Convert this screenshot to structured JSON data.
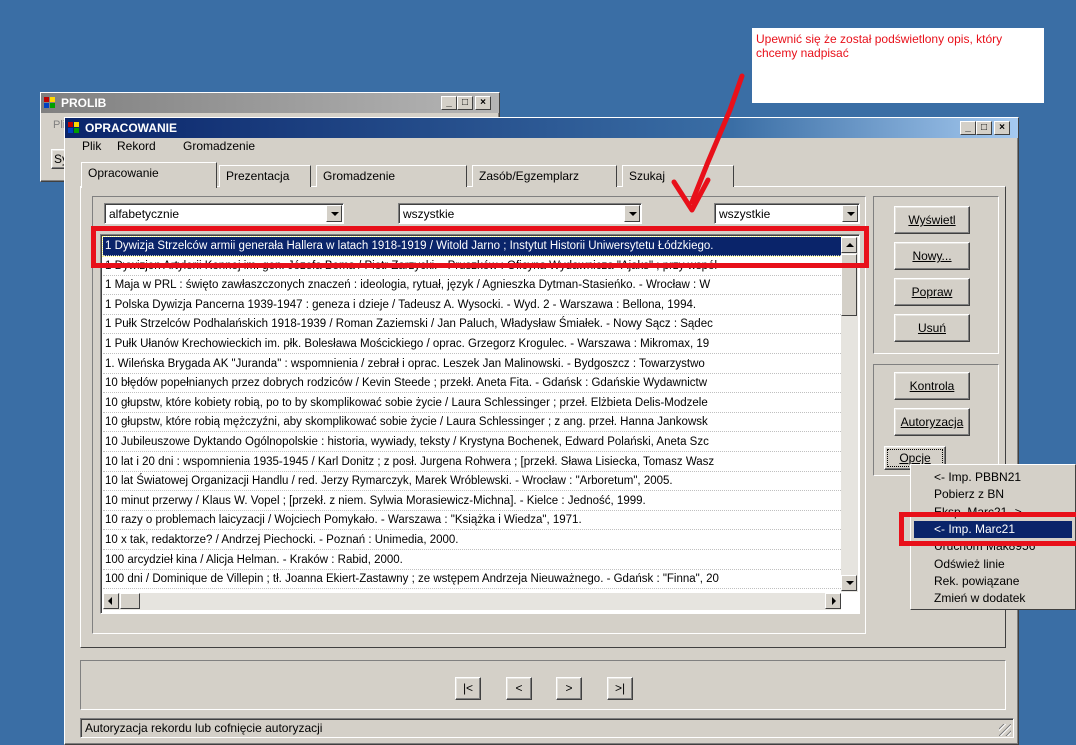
{
  "annotation": {
    "text": "Upewnić się że został podświetlony opis, który chcemy nadpisać",
    "color": "#e8101a"
  },
  "prolib": {
    "title": "PROLIB",
    "menu_partial": "Plik",
    "button_partial": "Sy"
  },
  "window": {
    "title": "OPRACOWANIE",
    "menu": [
      "Plik",
      "Rekord",
      "Gromadzenie"
    ],
    "tabs": [
      "Opracowanie",
      "Prezentacja",
      "Gromadzenie",
      "Zasób/Egzemplarz",
      "Szukaj"
    ],
    "filters": [
      "alfabetycznie",
      "wszystkie",
      "wszystkie"
    ],
    "buttons": {
      "wyswietl": "Wyświetl",
      "nowy": "Nowy...",
      "popraw": "Popraw",
      "usun": "Usuń",
      "kontrola": "Kontrola",
      "autoryzacja": "Autoryzacja",
      "opcje": "Opcje"
    },
    "nav": [
      "|<",
      "<",
      ">",
      ">|"
    ],
    "status": "Autoryzacja rekordu lub cofnięcie autoryzacji"
  },
  "records": [
    "1 Dywizja Strzelców armii generała Hallera w latach 1918-1919 / Witold Jarno ; Instytut Historii Uniwersytetu Łódzkiego.",
    "1 Dywizjon Artylerii Konnej im. gen. Józefa Bema / Piotr Zarzycki. - Pruszków : Oficyna Wydawnicza \"Ajaks\" ; przy współ",
    "1 Maja w PRL : święto zawłaszczonych znaczeń : ideologia, rytuał, język / Agnieszka Dytman-Stasieńko. - Wrocław : W",
    "1 Polska Dywizja Pancerna 1939-1947 : geneza i dzieje / Tadeusz A. Wysocki. - Wyd. 2 - Warszawa : Bellona, 1994.",
    "1 Pułk Strzelców Podhalańskich 1918-1939 / Roman Zaziemski / Jan Paluch, Władysław Śmiałek. - Nowy Sącz : Sądec",
    "1 Pułk Ułanów Krechowieckich im. płk. Bolesława Mościckiego / oprac. Grzegorz Krogulec. - Warszawa : Mikromax, 19",
    "1. Wileńska Brygada AK \"Juranda\" : wspomnienia / zebrał i oprac. Leszek Jan Malinowski. - Bydgoszcz : Towarzystwo",
    "10 błędów popełnianych przez dobrych rodziców / Kevin Steede ; przekł. Aneta Fita. - Gdańsk : Gdańskie Wydawnictw",
    "10 głupstw, które kobiety robią, po to by skomplikować sobie życie / Laura Schlessinger ; przeł. Elżbieta Delis-Modzele",
    "10 głupstw, które robią mężczyźni, aby skomplikować sobie życie / Laura Schlessinger ; z ang. przeł. Hanna Jankowsk",
    "10 Jubileuszowe Dyktando Ogólnopolskie : historia, wywiady, teksty / Krystyna Bochenek, Edward Polański, Aneta Szc",
    "10 lat i 20 dni : wspomnienia 1935-1945 / Karl Donitz ; z posł. Jurgena Rohwera ; [przekł. Sława Lisiecka, Tomasz Wasz",
    "10 lat Światowej Organizacji Handlu / red. Jerzy Rymarczyk, Marek Wróblewski. - Wrocław : \"Arboretum\", 2005.",
    "10 minut przerwy / Klaus W. Vopel ; [przekł. z niem. Sylwia Morasiewicz-Michna]. - Kielce : Jedność, 1999.",
    "10 razy o problemach laicyzacji / Wojciech Pomykało. - Warszawa : \"Książka i Wiedza\", 1971.",
    "10 x tak, redaktorze? / Andrzej Piechocki. - Poznań : Unimedia, 2000.",
    "100 arcydzieł kina / Alicja Helman. - Kraków : Rabid, 2000.",
    "100 dni / Dominique de Villepin ; tł. Joanna Ekiert-Zastawny ; ze wstępem Andrzeja Nieuważnego. - Gdańsk : \"Finna\", 20"
  ],
  "context_menu": [
    "<- Imp. PBBN21",
    "Pobierz z BN",
    "Eksp. Marc21 ->",
    "<- Imp. Marc21",
    "Uruchom Mak8956",
    "Odśwież linie",
    "Rek. powiązane",
    "Zmień w dodatek"
  ]
}
